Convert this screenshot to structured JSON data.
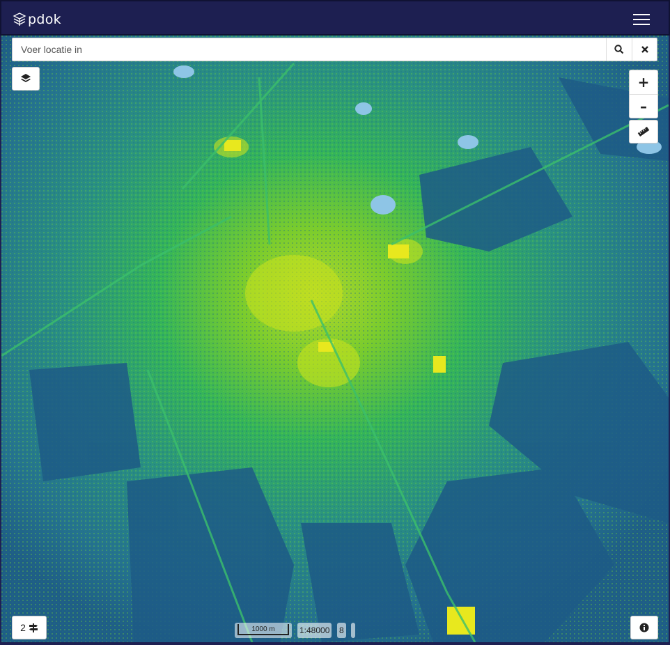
{
  "header": {
    "logo_text": "pdok",
    "menu_icon": "hamburger-menu-icon",
    "background": "#1d1f51"
  },
  "search": {
    "placeholder": "Voer locatie in",
    "value": "",
    "search_icon": "search-icon",
    "clear_icon": "close-icon"
  },
  "controls": {
    "layers_icon": "layers-icon",
    "zoom_in_label": "+",
    "zoom_out_label": "–",
    "measure_icon": "ruler-icon",
    "info_icon": "info-icon"
  },
  "legend_toggle": {
    "count": "2",
    "icon": "signpost-icon"
  },
  "footer": {
    "scale_label": "1000 m",
    "scale_ratio": "1:48000",
    "zoom_level": "8"
  },
  "colors": {
    "low": "#1e5f86",
    "mid": "#2a8a8a",
    "high": "#46c23a",
    "peak": "#e0e020",
    "water": "#8ec5e6"
  }
}
